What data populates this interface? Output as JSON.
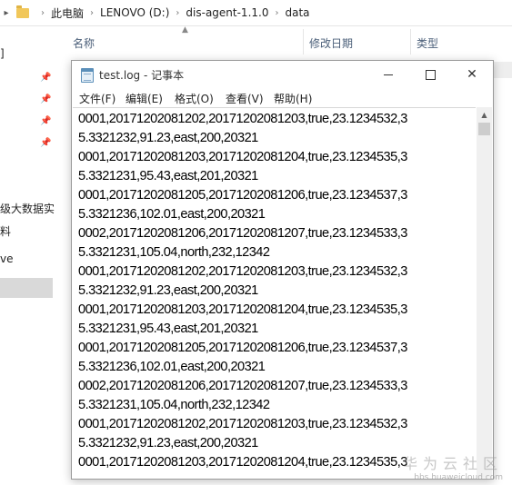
{
  "explorer": {
    "breadcrumb": [
      "此电脑",
      "LENOVO (D:)",
      "dis-agent-1.1.0",
      "data"
    ],
    "columns": {
      "name": "名称",
      "date": "修改日期",
      "type": "类型"
    },
    "left_pane": {
      "item_top": "]",
      "item_bigdata": "级大数据实",
      "item_material": "料",
      "item_drive": "ve"
    }
  },
  "notepad": {
    "title": "test.log - 记事本",
    "menu": [
      "文件(F)",
      "编辑(E)",
      "格式(O)",
      "查看(V)",
      "帮助(H)"
    ],
    "lines": [
      "0001,20171202081202,20171202081203,true,23.1234532,3",
      "5.3321232,91.23,east,200,20321",
      "0001,20171202081203,20171202081204,true,23.1234535,3",
      "5.3321231,95.43,east,201,20321",
      "0001,20171202081205,20171202081206,true,23.1234537,3",
      "5.3321236,102.01,east,200,20321",
      "0002,20171202081206,20171202081207,true,23.1234533,3",
      "5.3321231,105.04,north,232,12342",
      "0001,20171202081202,20171202081203,true,23.1234532,3",
      "5.3321232,91.23,east,200,20321",
      "0001,20171202081203,20171202081204,true,23.1234535,3",
      "5.3321231,95.43,east,201,20321",
      "0001,20171202081205,20171202081206,true,23.1234537,3",
      "5.3321236,102.01,east,200,20321",
      "0002,20171202081206,20171202081207,true,23.1234533,3",
      "5.3321231,105.04,north,232,12342",
      "0001,20171202081202,20171202081203,true,23.1234532,3",
      "5.3321232,91.23,east,200,20321",
      "0001,20171202081203,20171202081204,true,23.1234535,3"
    ]
  },
  "watermark": {
    "brand": "华为云社区",
    "url": "bbs.huaweicloud.com"
  }
}
